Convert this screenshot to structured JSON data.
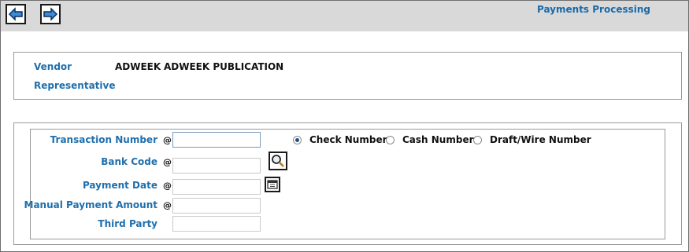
{
  "header": {
    "title": "Payments Processing",
    "back_icon": "arrow-left-icon",
    "forward_icon": "arrow-right-icon"
  },
  "vendor": {
    "vendor_label": "Vendor",
    "vendor_code": "ADWEEK",
    "vendor_name": "ADWEEK PUBLICATION",
    "representative_label": "Representative"
  },
  "payment": {
    "required_marker": "@",
    "transaction_number_label": "Transaction Number",
    "transaction_number_value": "",
    "bank_code_label": "Bank Code",
    "bank_code_value": "",
    "payment_date_label": "Payment Date",
    "payment_date_value": "",
    "manual_payment_amount_label": "Manual Payment Amount",
    "manual_payment_amount_value": "",
    "third_party_label": "Third Party",
    "third_party_value": "",
    "lookup_icon": "magnifier-icon",
    "calendar_icon": "calendar-icon",
    "payment_types": [
      {
        "label": "Check Number",
        "selected": true
      },
      {
        "label": "Cash Number",
        "selected": false
      },
      {
        "label": "Draft/Wire Number",
        "selected": false
      }
    ]
  },
  "colors": {
    "label_blue": "#1f6fad",
    "toolbar_gray": "#d9d9d9",
    "accent_blue": "#1a6aa8"
  }
}
